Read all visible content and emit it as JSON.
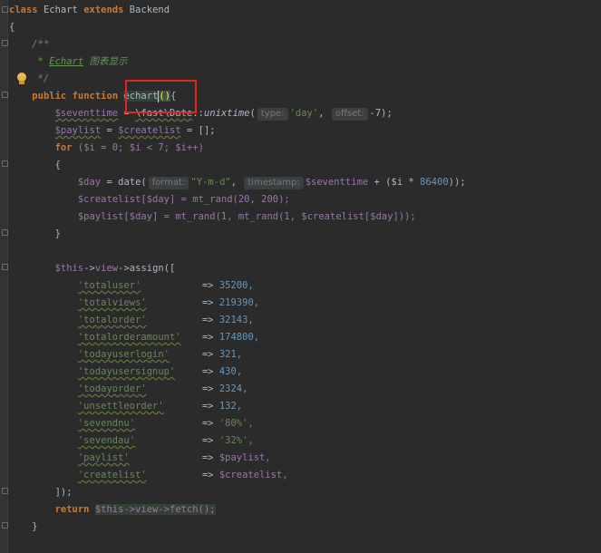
{
  "code": {
    "class_kw": "class",
    "class_name": "Echart",
    "extends_kw": "extends",
    "parent": "Backend",
    "open_brace": "{",
    "doc_open": "/**",
    "doc_star": "*",
    "doc_tag": "Echart",
    "doc_text": "图表显示",
    "doc_close": "*/",
    "public_kw": "public",
    "function_kw": "function",
    "method_name": "echart",
    "parens": "()",
    "method_brace": "{",
    "l_seventtime_var": "$seventtime",
    "l_seventtime_eq": " = ",
    "l_seventtime_cls": "\\fast\\Date",
    "l_seventtime_sep": "::",
    "l_seventtime_fn": "unixtime",
    "l_seventtime_open": "(",
    "hint_type": "type:",
    "l_seventtime_day": "'day'",
    "l_seventtime_comma": ",",
    "hint_offset": "offset:",
    "l_seventtime_rest": "-7);",
    "l_paylist_var": "$paylist",
    "l_paylist_mid": " = ",
    "l_createlist_var": "$createlist",
    "l_paylist_end": " = [];",
    "for_kw": "for",
    "for_body": " ($i = 0; $i < 7; $i++)",
    "for_open": "{",
    "l_day_var": "$day",
    "l_day_mid": " = date(",
    "hint_format": "format:",
    "l_day_fmt": "\"Y-m-d\"",
    "l_day_comma": ",",
    "hint_timestamp": "timestamp:",
    "l_day_seven": "$seventtime",
    "l_day_plus": " + ($i * ",
    "l_day_num": "86400",
    "l_day_end": "));",
    "l_create_line": "$createlist[$day] = mt_rand(20, 200);",
    "l_pay_line": "$paylist[$day] = mt_rand(1, mt_rand(1, $createlist[$day]));",
    "for_close": "}",
    "assign_this": "$this",
    "assign_arrow1": "->",
    "assign_view": "view",
    "assign_arrow2": "->",
    "assign_fn": "assign",
    "assign_open": "([",
    "arrow": "=>",
    "entries": [
      {
        "key": "'totaluser'",
        "value": "35200,"
      },
      {
        "key": "'totalviews'",
        "value": "219390,"
      },
      {
        "key": "'totalorder'",
        "value": "32143,"
      },
      {
        "key": "'totalorderamount'",
        "value": "174800,"
      },
      {
        "key": "'todayuserlogin'",
        "value": "321,"
      },
      {
        "key": "'todayusersignup'",
        "value": "430,"
      },
      {
        "key": "'todayorder'",
        "value": "2324,"
      },
      {
        "key": "'unsettleorder'",
        "value": "132,"
      },
      {
        "key": "'sevendnu'",
        "value": "'80%',"
      },
      {
        "key": "'sevendau'",
        "value": "'32%',"
      },
      {
        "key": "'paylist'",
        "value": "$paylist,"
      },
      {
        "key": "'createlist'",
        "value": "$createlist,"
      }
    ],
    "assign_close": "]);",
    "return_kw": "return",
    "return_expr": "$this->view->fetch();",
    "method_close": "}"
  }
}
